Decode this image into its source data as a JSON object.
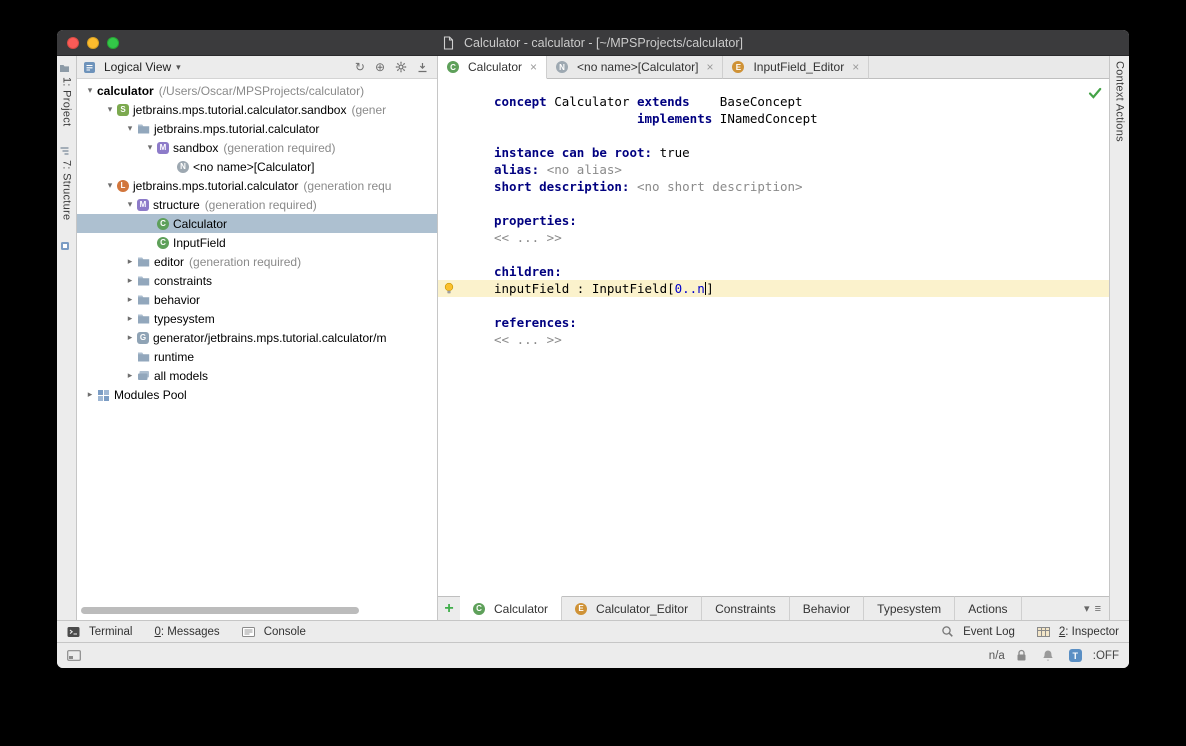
{
  "window": {
    "title": "Calculator - calculator - [~/MPSProjects/calculator]"
  },
  "icons": {
    "close": "×",
    "expanded": "▾",
    "collapsed": "▸",
    "dropdown": "▾",
    "menu": "≡",
    "plus": "+",
    "sync": "↻",
    "locate": "⊕"
  },
  "left_stripe": {
    "buttons": [
      {
        "icon": "project-stripe",
        "label": "1: Project"
      },
      {
        "icon": "structure-stripe",
        "label": "7: Structure"
      },
      {
        "icon": "tool-stripe",
        "label": ""
      }
    ]
  },
  "right_stripe": {
    "buttons": [
      {
        "label": "Context Actions"
      }
    ]
  },
  "project_panel": {
    "header": {
      "title": "Logical View"
    },
    "tree": [
      {
        "depth": 0,
        "arrow": "down",
        "label": "calculator",
        "suffix": "(/Users/Oscar/MPSProjects/calculator)",
        "bold": true
      },
      {
        "depth": 1,
        "arrow": "down",
        "icon": "solution",
        "label": "jetbrains.mps.tutorial.calculator.sandbox",
        "suffix": "(gener"
      },
      {
        "depth": 2,
        "arrow": "down",
        "icon": "folder",
        "label": "jetbrains.mps.tutorial.calculator",
        "suffix": ""
      },
      {
        "depth": 3,
        "arrow": "down",
        "icon": "model",
        "label": "sandbox",
        "suffix": "(generation required)"
      },
      {
        "depth": 4,
        "arrow": "none",
        "icon": "node",
        "label": "<no name>[Calculator]",
        "suffix": ""
      },
      {
        "depth": 1,
        "arrow": "down",
        "icon": "language",
        "label": "jetbrains.mps.tutorial.calculator",
        "suffix": "(generation requ"
      },
      {
        "depth": 2,
        "arrow": "down",
        "icon": "model",
        "label": "structure",
        "suffix": "(generation required)"
      },
      {
        "depth": 3,
        "arrow": "none",
        "icon": "concept",
        "label": "Calculator",
        "suffix": "",
        "selected": true
      },
      {
        "depth": 3,
        "arrow": "none",
        "icon": "concept",
        "label": "InputField",
        "suffix": ""
      },
      {
        "depth": 2,
        "arrow": "right",
        "icon": "folder",
        "label": "editor",
        "suffix": "(generation required)"
      },
      {
        "depth": 2,
        "arrow": "right",
        "icon": "folder",
        "label": "constraints",
        "suffix": ""
      },
      {
        "depth": 2,
        "arrow": "right",
        "icon": "folder",
        "label": "behavior",
        "suffix": ""
      },
      {
        "depth": 2,
        "arrow": "right",
        "icon": "folder",
        "label": "typesystem",
        "suffix": ""
      },
      {
        "depth": 2,
        "arrow": "right",
        "icon": "generator",
        "label": "generator/jetbrains.mps.tutorial.calculator/m",
        "suffix": ""
      },
      {
        "depth": 2,
        "arrow": "none",
        "icon": "folder",
        "label": "runtime",
        "suffix": ""
      },
      {
        "depth": 2,
        "arrow": "right",
        "icon": "stack",
        "label": "all models",
        "suffix": ""
      },
      {
        "depth": 0,
        "arrow": "right",
        "icon": "modules",
        "label": "Modules Pool",
        "suffix": ""
      }
    ]
  },
  "editor": {
    "tabs": [
      {
        "icon": "concept",
        "label": "Calculator",
        "active": true
      },
      {
        "icon": "node",
        "label": "<no name>[Calculator]",
        "active": false
      },
      {
        "icon": "editor-aspect",
        "label": "InputField_Editor",
        "active": false
      }
    ],
    "code_lines": [
      {
        "segments": [
          {
            "s": "kw",
            "t": "concept"
          },
          {
            "s": "plain",
            "t": " Calculator "
          },
          {
            "s": "kw",
            "t": "extends"
          },
          {
            "s": "plain",
            "t": "    BaseConcept"
          }
        ]
      },
      {
        "segments": [
          {
            "s": "plain",
            "t": "                   "
          },
          {
            "s": "kw",
            "t": "implements"
          },
          {
            "s": "plain",
            "t": " INamedConcept"
          }
        ]
      },
      {
        "segments": []
      },
      {
        "segments": [
          {
            "s": "kw",
            "t": "instance can be root:"
          },
          {
            "s": "plain",
            "t": " true"
          }
        ]
      },
      {
        "segments": [
          {
            "s": "kw",
            "t": "alias:"
          },
          {
            "s": "plain",
            "t": " "
          },
          {
            "s": "muted",
            "t": "<no alias>"
          }
        ]
      },
      {
        "segments": [
          {
            "s": "kw",
            "t": "short description:"
          },
          {
            "s": "plain",
            "t": " "
          },
          {
            "s": "muted",
            "t": "<no short description>"
          }
        ]
      },
      {
        "segments": []
      },
      {
        "segments": [
          {
            "s": "kw",
            "t": "properties:"
          }
        ]
      },
      {
        "segments": [
          {
            "s": "muted",
            "t": "<< ... >>"
          }
        ]
      },
      {
        "segments": []
      },
      {
        "segments": [
          {
            "s": "kw",
            "t": "children:"
          }
        ]
      },
      {
        "highlight": true,
        "bulb": true,
        "caret_after": 1,
        "segments": [
          {
            "s": "plain",
            "t": "inputField : InputField["
          },
          {
            "s": "num",
            "t": "0..n"
          },
          {
            "s": "plain",
            "t": "]"
          }
        ]
      },
      {
        "segments": []
      },
      {
        "segments": [
          {
            "s": "kw",
            "t": "references:"
          }
        ]
      },
      {
        "segments": [
          {
            "s": "muted",
            "t": "<< ... >>"
          }
        ]
      }
    ],
    "aspect_tabs": [
      {
        "icon": "concept",
        "label": "Calculator",
        "active": true
      },
      {
        "icon": "editor-aspect",
        "label": "Calculator_Editor",
        "active": false
      },
      {
        "label": "Constraints",
        "active": false
      },
      {
        "label": "Behavior",
        "active": false
      },
      {
        "label": "Typesystem",
        "active": false
      },
      {
        "label": "Actions",
        "active": false
      }
    ]
  },
  "bottom_bar": {
    "left": [
      {
        "icon": "terminal",
        "label": "Terminal"
      },
      {
        "label": "0: Messages",
        "mnemonic_underline": true
      },
      {
        "icon": "console",
        "label": "Console"
      }
    ],
    "right": [
      {
        "icon": "magnifier",
        "label": "Event Log"
      },
      {
        "icon": "inspector",
        "label": "2: Inspector",
        "mnemonic_underline": true
      }
    ]
  },
  "status_bar": {
    "na_text": "n/a",
    "toggle_label": "T",
    "toggle_state": ":OFF"
  },
  "colors": {
    "selection": "#adc0d0",
    "keyword": "#000080",
    "cardinality": "#0000cc",
    "highlight_line": "#fbf2cc",
    "ok_green": "#44a347",
    "titlebar": "#3b3b3d",
    "plus_green": "#3fae4a"
  }
}
